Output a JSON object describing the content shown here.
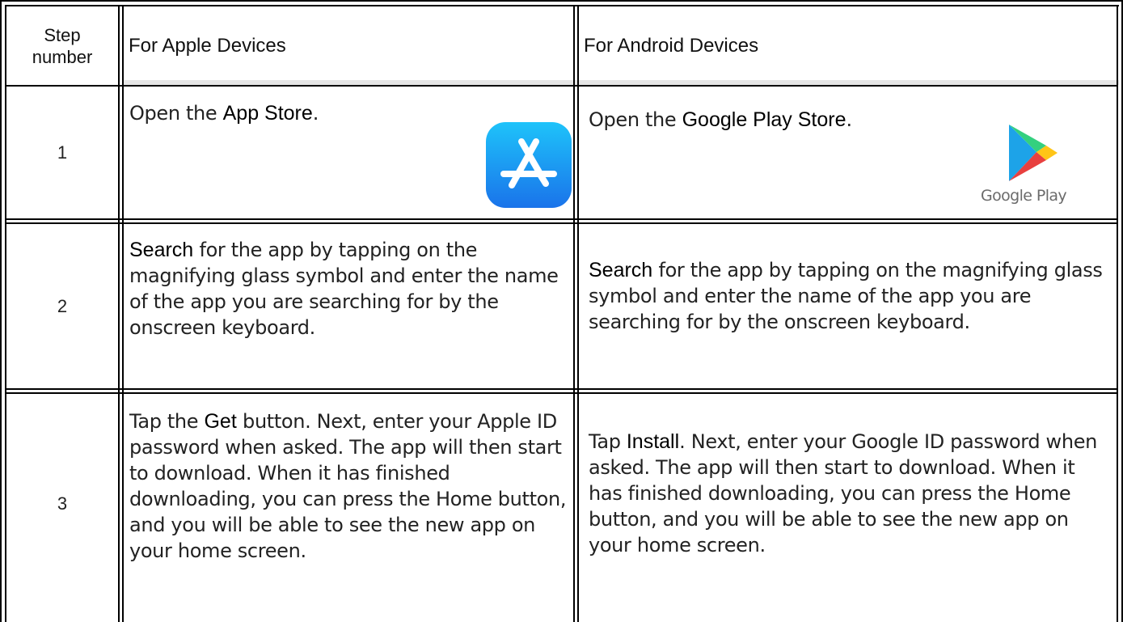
{
  "table": {
    "headers": {
      "step": "Step number",
      "apple": "For Apple Devices",
      "android": "For Android Devices"
    },
    "rows": [
      {
        "number": "1",
        "apple": {
          "bold": "App Store",
          "before": "Open the ",
          "after": "."
        },
        "android": {
          "bold": "Google Play Store",
          "before": "Open the ",
          "after": "."
        }
      },
      {
        "number": "2",
        "apple": {
          "bold": "Search",
          "after": " for the app by tapping on the magnifying glass symbol and enter the name of the app you are searching for by the onscreen keyboard."
        },
        "android": {
          "bold": "Search",
          "after": " for the app by tapping on the magnifying glass symbol and enter the name of the app you are searching for by the onscreen keyboard."
        }
      },
      {
        "number": "3",
        "apple": {
          "before": "Tap the ",
          "bold": "Get",
          "after": " button. Next, enter your Apple ID password when asked. The app will then start to download. When it has finished downloading, you can press the Home button, and you will be able to see the new app on your home screen."
        },
        "android": {
          "before": "Tap ",
          "bold": "Install",
          "after": ". Next, enter your Google ID password when asked. The app will then start to download. When it has finished downloading, you can press the Home button, and you will be able to see the new app on your home screen."
        }
      }
    ]
  },
  "logos": {
    "app_store_icon": "app-store-icon",
    "google_play_icon": "google-play-icon",
    "google_play_wordmark": "Google Play"
  },
  "colors": {
    "app_store_gradient_top": "#1EC3FA",
    "app_store_gradient_bottom": "#1A73EA"
  }
}
